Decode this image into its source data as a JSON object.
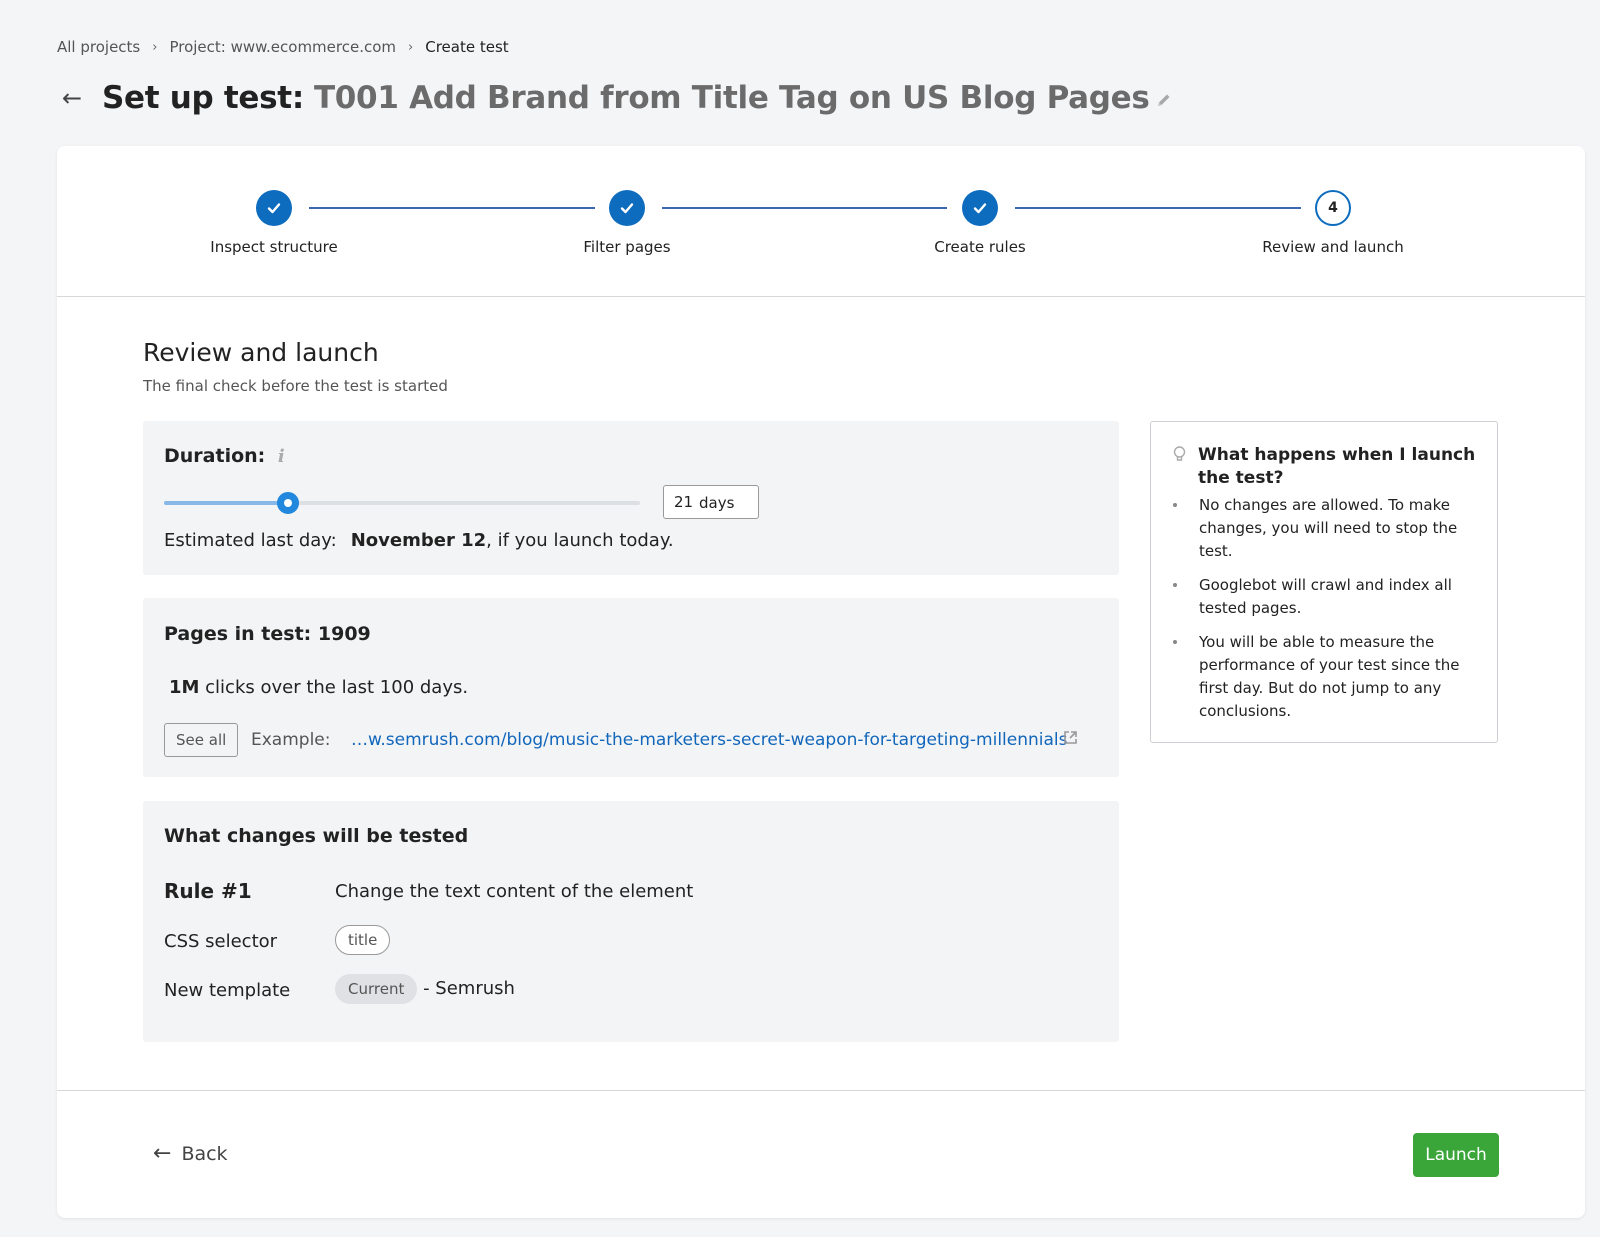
{
  "breadcrumb": [
    {
      "label": "All projects"
    },
    {
      "label": "Project: www.ecommerce.com"
    },
    {
      "label": "Create test"
    }
  ],
  "header": {
    "title_prefix": "Set up test:",
    "test_name": "T001 Add Brand from Title Tag on US Blog Pages"
  },
  "stepper": {
    "steps": [
      {
        "label": "Inspect structure",
        "status": "done"
      },
      {
        "label": "Filter pages",
        "status": "done"
      },
      {
        "label": "Create rules",
        "status": "done"
      },
      {
        "label": "Review and launch",
        "status": "current",
        "number": "4"
      }
    ],
    "color": "#0e6cbf"
  },
  "section": {
    "title": "Review and launch",
    "subtitle": "The final check before the test is started"
  },
  "duration": {
    "title": "Duration:",
    "info_icon": "i",
    "slider_fraction": 0.26,
    "days_value": "21",
    "days_unit": "days",
    "estimate_label": "Estimated last day:",
    "estimate_date": "November 12",
    "estimate_suffix": ", if you launch today."
  },
  "pages": {
    "title": "Pages in test: 1909",
    "clicks_value": "1M",
    "clicks_text": " clicks over the last 100 days.",
    "see_all_label": "See all",
    "example_label": "Example:",
    "example_url": "…w.semrush.com/blog/music-the-marketers-secret-weapon-for-targeting-millennials"
  },
  "changes": {
    "title": "What changes will be tested",
    "rule_title": "Rule #1",
    "rule_desc": "Change the text content of the element",
    "css_label": "CSS selector",
    "css_value": "title",
    "template_label": "New template",
    "template_chip": "Current",
    "template_suffix": "- Semrush"
  },
  "info_box": {
    "title": "What happens when I launch the test?",
    "items": [
      "No changes are allowed. To make changes, you will need to stop the test.",
      "Googlebot will crawl and index all tested pages.",
      "You will be able to measure the performance of your test since the first day. But do not jump to any conclusions."
    ]
  },
  "footer": {
    "back_label": "Back",
    "launch_label": "Launch",
    "launch_color": "#3aa63a"
  }
}
